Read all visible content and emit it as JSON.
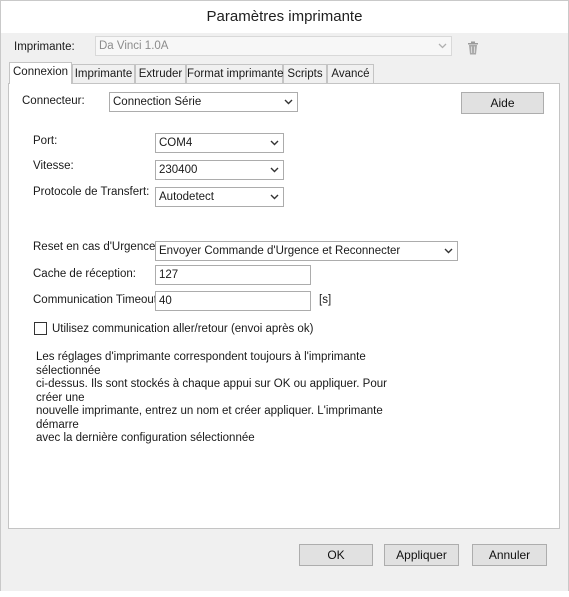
{
  "window": {
    "title": "Paramètres imprimante"
  },
  "printer": {
    "label": "Imprimante:",
    "value": "Da Vinci 1.0A"
  },
  "tabs": [
    {
      "label": "Connexion"
    },
    {
      "label": "Imprimante"
    },
    {
      "label": "Extruder"
    },
    {
      "label": "Format imprimante"
    },
    {
      "label": "Scripts"
    },
    {
      "label": "Avancé"
    }
  ],
  "connection": {
    "connector_label": "Connecteur:",
    "connector_value": "Connection Série",
    "help_label": "Aide",
    "port_label": "Port:",
    "port_value": "COM4",
    "speed_label": "Vitesse:",
    "speed_value": "230400",
    "protocol_label": "Protocole de Transfert:",
    "protocol_value": "Autodetect",
    "reset_label": "Reset en cas d'Urgence",
    "reset_value": "Envoyer Commande d'Urgence et Reconnecter",
    "cache_label": "Cache de réception:",
    "cache_value": "127",
    "timeout_label": "Communication Timeout:",
    "timeout_value": "40",
    "timeout_unit": "[s]",
    "pingpong_label": "Utilisez communication aller/retour (envoi après ok)",
    "pingpong_checked": false,
    "info_lines": [
      "Les réglages d'imprimante correspondent toujours à l'imprimante sélectionnée",
      "ci-dessus. Ils sont stockés à chaque appui sur OK ou appliquer. Pour créer une",
      "nouvelle imprimante, entrez un nom et créer appliquer. L'imprimante démarre",
      "avec la dernière configuration sélectionnée"
    ]
  },
  "buttons": {
    "ok": "OK",
    "apply": "Appliquer",
    "cancel": "Annuler"
  }
}
